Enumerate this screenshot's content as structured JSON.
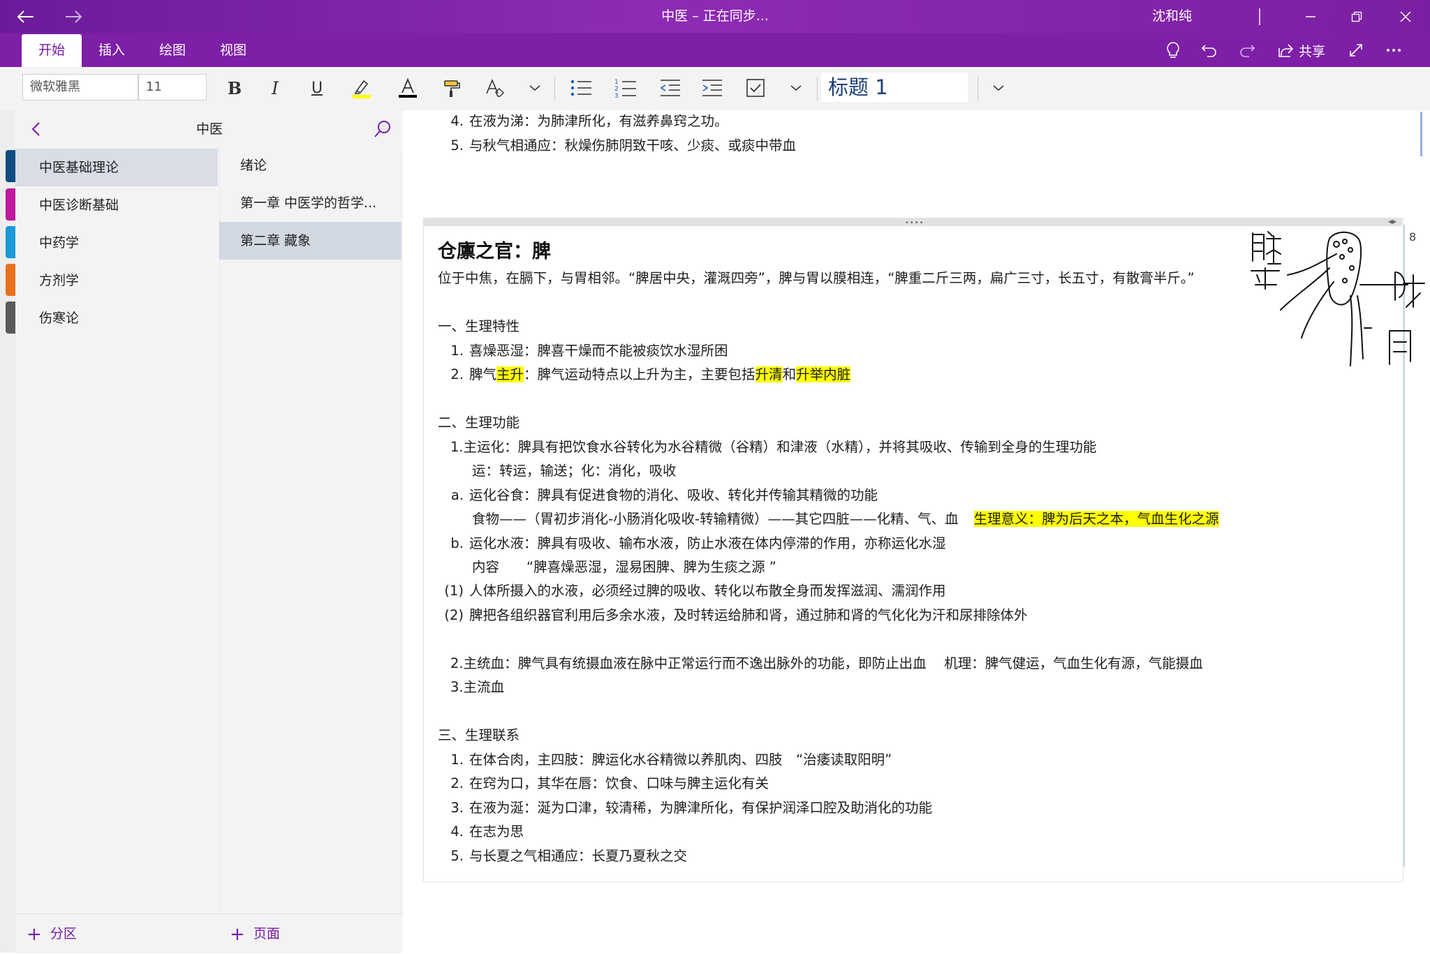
{
  "titlebar": {
    "doc_title": "中医 – 正在同步...",
    "user": "沈和纯"
  },
  "ribbon": {
    "tabs": [
      "开始",
      "插入",
      "绘图",
      "视图"
    ],
    "active_tab": "开始",
    "share_label": "共享"
  },
  "toolbar": {
    "font_name": "微软雅黑",
    "font_size": "11",
    "style_name": "标题 1",
    "highlight_color": "#ffff00",
    "font_color": "#000000"
  },
  "nav": {
    "notebook_title": "中医",
    "sections": [
      {
        "label": "中医基础理论",
        "color": "#0f4c81",
        "selected": true
      },
      {
        "label": "中医诊断基础",
        "color": "#c0189d",
        "selected": false
      },
      {
        "label": "中药学",
        "color": "#1a9ad6",
        "selected": false
      },
      {
        "label": "方剂学",
        "color": "#e8711e",
        "selected": false
      },
      {
        "label": "伤寒论",
        "color": "#5a5a5a",
        "selected": false
      }
    ],
    "pages": [
      {
        "label": "绪论",
        "selected": false
      },
      {
        "label": "第一章 中医学的哲学...",
        "selected": false
      },
      {
        "label": "第二章 藏象",
        "selected": true
      }
    ],
    "add_section": "分区",
    "add_page": "页面"
  },
  "note_top": [
    {
      "num": "4.",
      "text": "在液为涕：为肺津所化，有滋养鼻窍之功。"
    },
    {
      "num": "5.",
      "text": "与秋气相通应：秋燥伤肺阴致干咳、少痰、或痰中带血"
    }
  ],
  "note": {
    "title": "仓廪之官：脾",
    "page_number": "8",
    "intro": "位于中焦，在膈下，与胃相邻。“脾居中央，灌溉四旁”，脾与胃以膜相连，“脾重二斤三两，扁广三寸，长五寸，有散膏半斤。”",
    "s1_title": "一、生理特性",
    "s1_1_num": "1.",
    "s1_1": "喜燥恶湿：脾喜干燥而不能被痰饮水湿所困",
    "s1_2_num": "2.",
    "s1_2_a": "脾气",
    "s1_2_b": "主升",
    "s1_2_c": "：脾气运动特点以上升为主，主要包括",
    "s1_2_d": "升清",
    "s1_2_e": "和",
    "s1_2_f": "升举内脏",
    "s2_title": "二、生理功能",
    "s2_1": "1.主运化：脾具有把饮食水谷转化为水谷精微（谷精）和津液（水精），并将其吸收、传输到全身的生理功能",
    "s2_1_sub": "运：转运，输送；化：消化，吸收",
    "s2_a_num": "a.",
    "s2_a": "运化谷食：脾具有促进食物的消化、吸收、转化并传输其精微的功能",
    "s2_a_sub": "食物——（胃初步消化-小肠消化吸收-转输精微）——其它四脏——化精、气、血",
    "s2_a_hl": "生理意义：脾为后天之本，气血生化之源",
    "s2_b_num": "b.",
    "s2_b": "运化水液：脾具有吸收、输布水液，防止水液在体内停滞的作用，亦称运化水湿",
    "s2_b_sub": "内容　　“脾喜燥恶湿，湿易困脾、脾为生痰之源 ”",
    "s2_p1_num": "(1)",
    "s2_p1": "人体所摄入的水液，必须经过脾的吸收、转化以布散全身而发挥滋润、濡润作用",
    "s2_p2_num": "(2)",
    "s2_p2": "脾把各组织器官利用后多余水液，及时转运给肺和肾，通过肺和肾的气化化为汗和尿排除体外",
    "s2_2": "2.主统血：脾气具有统摄血液在脉中正常运行而不逸出脉外的功能，即防止出血　 机理：脾气健运，气血生化有源，气能摄血",
    "s2_3": "3.主流血",
    "s3_title": "三、生理联系",
    "s3_items": [
      {
        "num": "1.",
        "text": "在体合肉，主四肢：脾运化水谷精微以养肌肉、四肢　“治痿读取阳明”"
      },
      {
        "num": "2.",
        "text": "在窍为口，其华在唇：饮食、口味与脾主运化有关"
      },
      {
        "num": "3.",
        "text": "在液为涎：涎为口津，较清稀，为脾津所化，有保护润泽口腔及助消化的功能"
      },
      {
        "num": "4.",
        "text": "在志为思"
      },
      {
        "num": "5.",
        "text": "与长夏之气相通应：长夏乃夏秋之交"
      }
    ]
  }
}
